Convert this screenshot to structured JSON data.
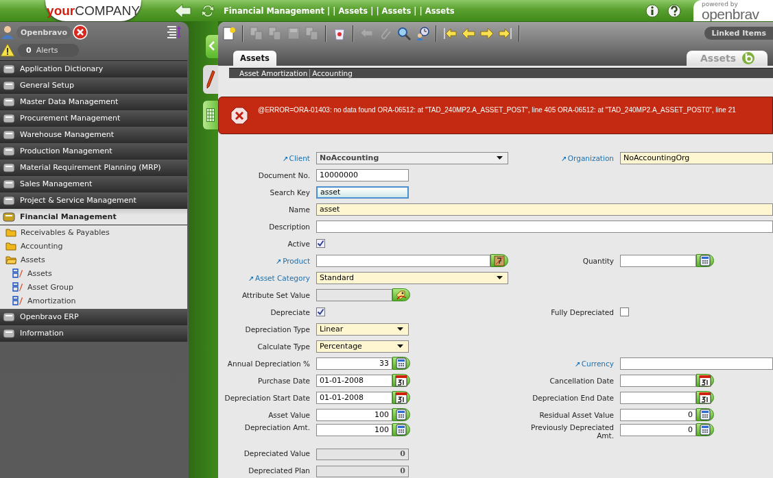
{
  "header": {
    "logo_a": "your",
    "logo_b": "COMPANY",
    "breadcrumb": "Financial Management | | Assets | | Assets | | Assets",
    "powered_by": "powered by",
    "brand": "openbrav"
  },
  "user": {
    "name": "Openbravo"
  },
  "alerts": {
    "count": "0",
    "label": "Alerts"
  },
  "menu": [
    {
      "label": "Application Dictionary",
      "expanded": false
    },
    {
      "label": "General Setup",
      "expanded": false
    },
    {
      "label": "Master Data Management",
      "expanded": false
    },
    {
      "label": "Procurement Management",
      "expanded": false
    },
    {
      "label": "Warehouse Management",
      "expanded": false
    },
    {
      "label": "Production Management",
      "expanded": false
    },
    {
      "label": "Material Requirement Planning (MRP)",
      "expanded": false
    },
    {
      "label": "Sales Management",
      "expanded": false
    },
    {
      "label": "Project & Service Management",
      "expanded": false
    },
    {
      "label": "Financial Management",
      "expanded": true,
      "children": [
        {
          "label": "Receivables & Payables",
          "kind": "folder",
          "expanded": false
        },
        {
          "label": "Accounting",
          "kind": "folder",
          "expanded": false
        },
        {
          "label": "Assets",
          "kind": "folder",
          "expanded": true,
          "children": [
            {
              "label": "Assets",
              "kind": "window"
            },
            {
              "label": "Asset Group",
              "kind": "window"
            },
            {
              "label": "Amortization",
              "kind": "window"
            }
          ]
        }
      ]
    },
    {
      "label": "Openbravo ERP",
      "expanded": false
    },
    {
      "label": "Information",
      "expanded": false
    }
  ],
  "toolbar": [
    {
      "kind": "new",
      "disabled": false
    },
    {
      "kind": "sep"
    },
    {
      "kind": "copy",
      "disabled": true
    },
    {
      "kind": "copy",
      "disabled": true
    },
    {
      "kind": "save",
      "disabled": true
    },
    {
      "kind": "copy",
      "disabled": true
    },
    {
      "kind": "sep"
    },
    {
      "kind": "delete",
      "disabled": false
    },
    {
      "kind": "sep"
    },
    {
      "kind": "undo",
      "disabled": true
    },
    {
      "kind": "attach",
      "disabled": true
    },
    {
      "kind": "search",
      "disabled": false
    },
    {
      "kind": "audit",
      "disabled": false
    },
    {
      "kind": "sep"
    },
    {
      "kind": "first",
      "disabled": false
    },
    {
      "kind": "previous",
      "disabled": false
    },
    {
      "kind": "next",
      "disabled": false
    },
    {
      "kind": "last",
      "disabled": false
    },
    {
      "kind": "sep"
    }
  ],
  "linked_items": "Linked Items",
  "tabs": [
    {
      "label": "Assets",
      "selected": true
    }
  ],
  "window_tab": "Assets",
  "subtabs": [
    {
      "label": "Asset Amortization"
    },
    {
      "label": "Accounting"
    }
  ],
  "error": {
    "message": "@ERROR=ORA-01403: no data found ORA-06512: at \"TAD_240MP2.A_ASSET_POST\", line 405 ORA-06512: at \"TAD_240MP2.A_ASSET_POST0\", line 21"
  },
  "form": [
    {
      "fields": [
        {
          "label": "Client",
          "kind": "wideselect",
          "value": "NoAccounting",
          "link": true,
          "required": false,
          "readonly": true
        },
        {
          "label": "Organization",
          "kind": "longtext",
          "value": "NoAccountingOrg",
          "link": true,
          "required": true
        }
      ]
    },
    {
      "fields": [
        {
          "label": "Document No.",
          "kind": "text",
          "value": "10000000",
          "required": false
        }
      ]
    },
    {
      "fields": [
        {
          "label": "Search Key",
          "kind": "text",
          "value": "asset",
          "focused": true
        }
      ]
    },
    {
      "fields": [
        {
          "label": "Name",
          "kind": "longtext",
          "value": "asset",
          "required": true
        }
      ]
    },
    {
      "fields": [
        {
          "label": "Description",
          "kind": "longtext",
          "required": false
        }
      ]
    },
    {
      "fields": [
        {
          "label": "Active",
          "kind": "checkbox",
          "checked": true
        }
      ]
    },
    {
      "fields": [
        {
          "label": "Product",
          "kind": "product",
          "link": true,
          "required": false
        },
        {
          "label": "Quantity",
          "kind": "number"
        }
      ]
    },
    {
      "fields": [
        {
          "label": "Asset Category",
          "kind": "wideselect",
          "value": "Standard",
          "link": true,
          "required": true,
          "readonly": false
        }
      ]
    },
    {
      "fields": [
        {
          "label": "Attribute Set Value",
          "kind": "attribute"
        }
      ]
    },
    {
      "fields": [
        {
          "label": "Depreciate",
          "kind": "checkbox",
          "checked": true
        },
        {
          "label": "Fully Depreciated",
          "kind": "checkbox",
          "checked": false
        }
      ]
    },
    {
      "fields": [
        {
          "label": "Depreciation Type",
          "kind": "select",
          "value": "Linear",
          "required": true,
          "readonly": false
        }
      ]
    },
    {
      "fields": [
        {
          "label": "Calculate Type",
          "kind": "select",
          "value": "Percentage",
          "required": true,
          "readonly": false
        }
      ]
    },
    {
      "fields": [
        {
          "label": "Annual Depreciation %",
          "kind": "number",
          "value": "33"
        },
        {
          "label": "Currency",
          "kind": "longtext",
          "link": true,
          "required": false
        }
      ]
    },
    {
      "fields": [
        {
          "label": "Purchase Date",
          "kind": "date",
          "value": "01-01-2008"
        },
        {
          "label": "Cancellation Date",
          "kind": "date"
        }
      ]
    },
    {
      "fields": [
        {
          "label": "Depreciation Start Date",
          "kind": "date",
          "value": "01-01-2008"
        },
        {
          "label": "Depreciation End Date",
          "kind": "date"
        }
      ]
    },
    {
      "fields": [
        {
          "label": "Asset Value",
          "kind": "number",
          "value": "100"
        },
        {
          "label": "Residual Asset Value",
          "kind": "number",
          "value": "0"
        }
      ]
    },
    {
      "fields": [
        {
          "label": "Depreciation Amt.",
          "kind": "number",
          "value": "100"
        },
        {
          "label": "Previously Depreciated Amt.",
          "kind": "number",
          "value": "0"
        }
      ]
    },
    {
      "fields": [
        {
          "label": "Depreciated Value",
          "kind": "readonly",
          "value": "0"
        }
      ]
    },
    {
      "fields": [
        {
          "label": "Depreciated Plan",
          "kind": "readonly",
          "value": "0"
        }
      ]
    }
  ]
}
